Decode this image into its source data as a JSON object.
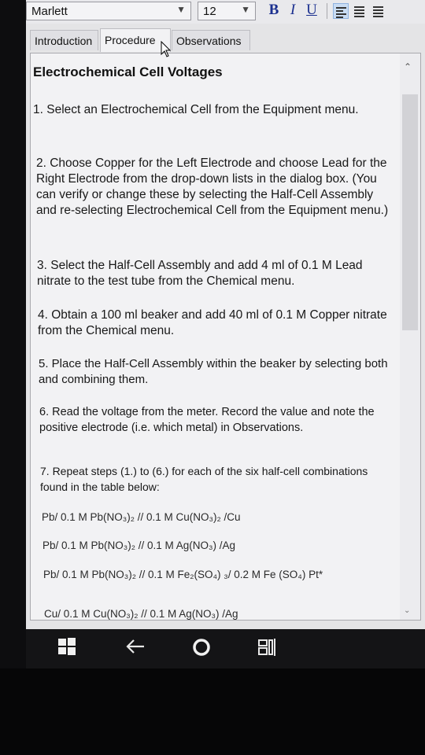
{
  "toolbar": {
    "font_name": "Marlett",
    "font_size": "12",
    "bold_label": "B",
    "italic_label": "I",
    "underline_label": "U",
    "align_icons": [
      "align-left-icon",
      "align-center-icon",
      "align-right-icon"
    ]
  },
  "tabs": [
    {
      "label": "Introduction",
      "active": false
    },
    {
      "label": "Procedure",
      "active": true
    },
    {
      "label": "Observations",
      "active": false
    }
  ],
  "content": {
    "title": "Electrochemical Cell Voltages",
    "steps": [
      "1. Select an Electrochemical Cell from the Equipment menu.",
      "2. Choose Copper for the Left Electrode and choose Lead for the Right Electrode from the drop-down lists in the dialog box. (You can verify or change these by selecting the Half-Cell Assembly and re-selecting Electrochemical Cell from the Equipment menu.)",
      "3. Select the Half-Cell Assembly and add 4 ml of 0.1 M Lead nitrate to the test tube from the Chemical menu.",
      "4. Obtain a 100 ml beaker and add 40 ml of 0.1 M Copper nitrate from the Chemical menu.",
      "5. Place the Half-Cell Assembly within the beaker by selecting both and combining them.",
      "6. Read the voltage from the meter. Record the value and note the positive electrode (i.e. which metal) in Observations.",
      "7. Repeat steps (1.) to (6.) for each of the six half-cell combinations found in the table below:"
    ],
    "combinations": [
      "Pb/ 0.1 M Pb(NO₃)₂ // 0.1 M Cu(NO₃)₂ /Cu",
      "Pb/ 0.1 M Pb(NO₃)₂ // 0.1 M Ag(NO₃) /Ag",
      "Pb/ 0.1 M Pb(NO₃)₂ // 0.1 M Fe₂(SO₄) ₃/ 0.2 M Fe (SO₄) Pt*",
      "Cu/ 0.1 M Cu(NO₃)₂ // 0.1 M Ag(NO₃) /Ag"
    ]
  },
  "colors": {
    "app_background": "#e4e4e6",
    "panel_background": "#f2f2f4",
    "format_button": "#1a2f8f",
    "taskbar": "#141416"
  },
  "taskbar": {
    "icons": [
      "windows-start-icon",
      "back-arrow-icon",
      "cortana-circle-icon",
      "task-view-icon"
    ]
  }
}
